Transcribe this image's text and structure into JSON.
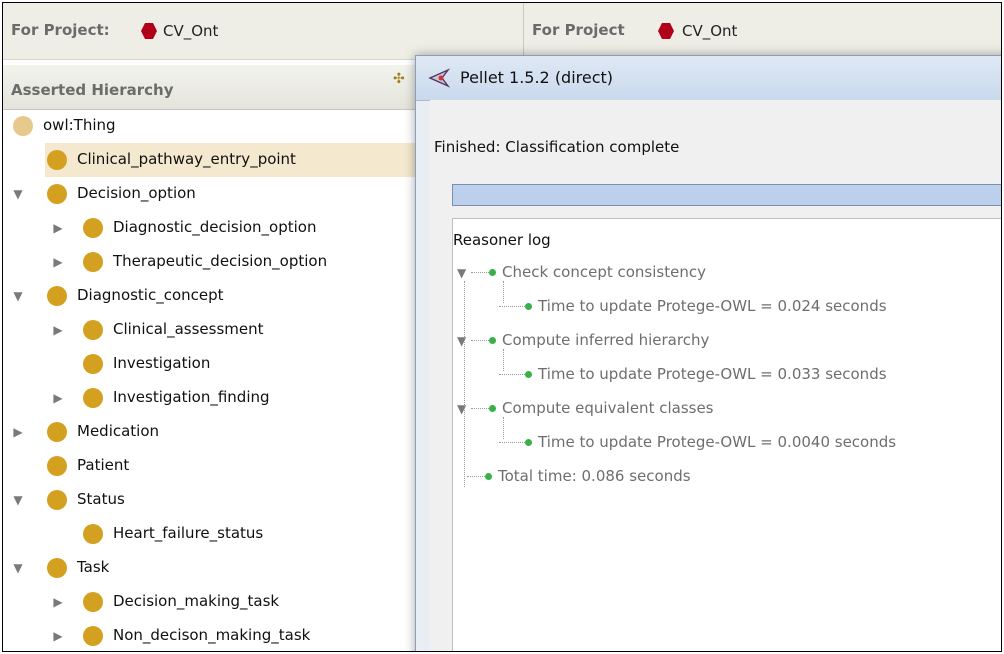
{
  "left_pane": {
    "project_label": "For Project:",
    "project_name": "CV_Ont",
    "hierarchy_title": "Asserted Hierarchy",
    "tree": [
      {
        "label": "owl:Thing",
        "depth": 0,
        "toggle": "none",
        "selected": false
      },
      {
        "label": "Clinical_pathway_entry_point",
        "depth": 1,
        "toggle": "none",
        "selected": true
      },
      {
        "label": "Decision_option",
        "depth": 1,
        "toggle": "expanded",
        "selected": false
      },
      {
        "label": "Diagnostic_decision_option",
        "depth": 2,
        "toggle": "collapsed",
        "selected": false
      },
      {
        "label": "Therapeutic_decision_option",
        "depth": 2,
        "toggle": "collapsed",
        "selected": false
      },
      {
        "label": "Diagnostic_concept",
        "depth": 1,
        "toggle": "expanded",
        "selected": false
      },
      {
        "label": "Clinical_assessment",
        "depth": 2,
        "toggle": "collapsed",
        "selected": false
      },
      {
        "label": "Investigation",
        "depth": 2,
        "toggle": "none",
        "selected": false
      },
      {
        "label": "Investigation_finding",
        "depth": 2,
        "toggle": "collapsed",
        "selected": false
      },
      {
        "label": "Medication",
        "depth": 1,
        "toggle": "collapsed",
        "selected": false
      },
      {
        "label": "Patient",
        "depth": 1,
        "toggle": "none",
        "selected": false
      },
      {
        "label": "Status",
        "depth": 1,
        "toggle": "expanded",
        "selected": false
      },
      {
        "label": "Heart_failure_status",
        "depth": 2,
        "toggle": "none",
        "selected": false
      },
      {
        "label": "Task",
        "depth": 1,
        "toggle": "expanded",
        "selected": false
      },
      {
        "label": "Decision_making_task",
        "depth": 2,
        "toggle": "collapsed",
        "selected": false
      },
      {
        "label": "Non_decison_making_task",
        "depth": 2,
        "toggle": "collapsed",
        "selected": false
      }
    ]
  },
  "right_pane": {
    "project_label": "For Project",
    "project_name": "CV_Ont"
  },
  "dialog": {
    "title": "Pellet 1.5.2 (direct)",
    "status": "Finished: Classification complete",
    "progress": 1.0,
    "log_title": "Reasoner log",
    "log": [
      {
        "text": "Check concept consistency",
        "level": 0,
        "toggle": true
      },
      {
        "text": "Time to update Protege-OWL = 0.024 seconds",
        "level": 1,
        "toggle": false
      },
      {
        "text": "Compute inferred hierarchy",
        "level": 0,
        "toggle": true
      },
      {
        "text": "Time to update Protege-OWL = 0.033 seconds",
        "level": 1,
        "toggle": false
      },
      {
        "text": "Compute equivalent classes",
        "level": 0,
        "toggle": true
      },
      {
        "text": "Time to update Protege-OWL = 0.0040 seconds",
        "level": 1,
        "toggle": false
      },
      {
        "text": "Total time: 0.086 seconds",
        "level": 0,
        "toggle": false
      }
    ]
  },
  "colors": {
    "class_dot": "#d4a01f",
    "root_dot": "#e7c98b",
    "project_hex": "#b0001a",
    "log_dot": "#3ab04a"
  }
}
